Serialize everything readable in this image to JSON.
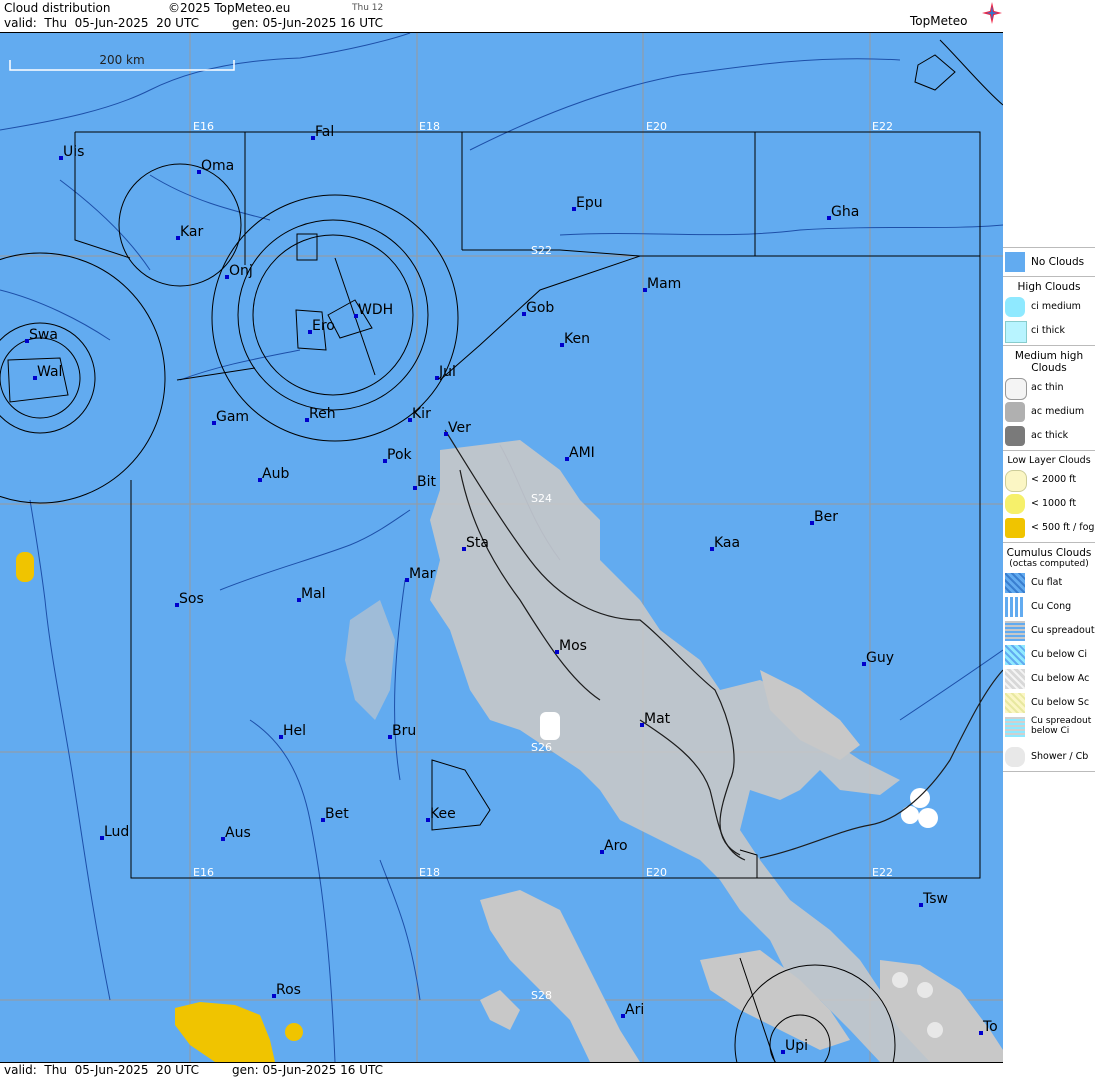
{
  "header": {
    "title": "Cloud distribution",
    "copyright": "©2025 TopMeteo.eu",
    "day_tag": "Thu 12",
    "valid": "valid:  Thu  05-Jun-2025  20 UTC",
    "generated": "gen: 05-Jun-2025 16 UTC"
  },
  "brand": {
    "logo_text": "TopMeteo",
    "icon": "compass-star-icon"
  },
  "footer": {
    "valid": "valid:  Thu  05-Jun-2025  20 UTC",
    "generated": "gen: 05-Jun-2025 16 UTC"
  },
  "map": {
    "scale_label": "200 km",
    "colors": {
      "ocean_land": "#62abf0",
      "cloud_ac": "#c8c8c8",
      "fog": "#f0c400",
      "grid": "#9a9a9a"
    },
    "grid_labels": {
      "lon_top": [
        "E16",
        "E18",
        "E20",
        "E22"
      ],
      "lon_bottom": [
        "E16",
        "E18",
        "E20",
        "E22"
      ],
      "lat": [
        "S22",
        "S24",
        "S26",
        "S28"
      ]
    },
    "places": [
      "Uis",
      "Fal",
      "Oma",
      "Kar",
      "Onj",
      "Swa",
      "Wal",
      "Ero",
      "WDH",
      "Epu",
      "Gha",
      "Gob",
      "Mam",
      "Ken",
      "Jul",
      "Gam",
      "Reh",
      "Kir",
      "Ver",
      "Pok",
      "AMI",
      "Aub",
      "Bit",
      "Sta",
      "Mar",
      "Ber",
      "Kaa",
      "Sos",
      "Mal",
      "Mos",
      "Guy",
      "Mat",
      "Hel",
      "Bru",
      "Bet",
      "Kee",
      "Lud",
      "Aus",
      "Aro",
      "Tsw",
      "Ros",
      "Ari",
      "Upi",
      "To"
    ]
  },
  "legend": {
    "no_clouds": "No Clouds",
    "high_title": "High Clouds",
    "high_items": [
      "ci medium",
      "ci thick"
    ],
    "medium_title": "Medium high Clouds",
    "medium_items": [
      "ac thin",
      "ac medium",
      "ac thick"
    ],
    "low_title": "Low Layer Clouds",
    "low_items": [
      "< 2000 ft",
      "< 1000 ft",
      "< 500 ft / fog"
    ],
    "cu_title": "Cumulus Clouds",
    "cu_subtitle": "(octas computed)",
    "cu_items": [
      "Cu flat",
      "Cu Cong",
      "Cu spreadout",
      "Cu below Ci",
      "Cu below Ac",
      "Cu below Sc",
      "Cu spreadout below Ci",
      "Shower / Cb"
    ]
  }
}
